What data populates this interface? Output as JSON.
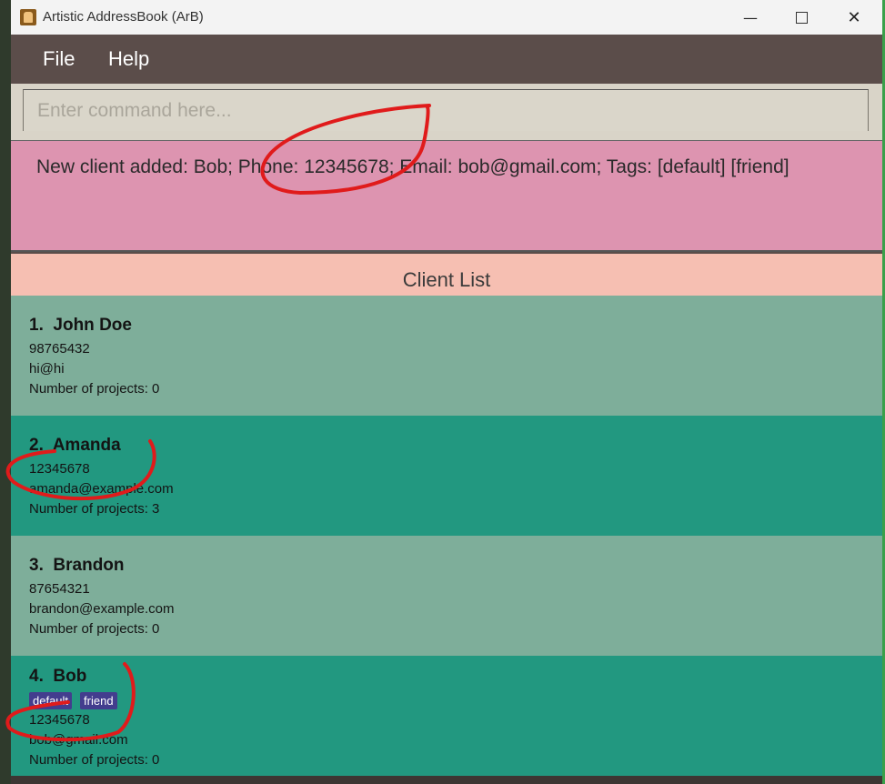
{
  "window": {
    "title": "Artistic AddressBook (ArB)"
  },
  "window_controls": {
    "minimize": "—",
    "close": "✕"
  },
  "menu": {
    "file": "File",
    "help": "Help"
  },
  "command": {
    "placeholder": "Enter command here...",
    "value": ""
  },
  "result": {
    "message": "New client added: Bob; Phone: 12345678; Email: bob@gmail.com; Tags: [default] [friend]"
  },
  "client_list": {
    "title": "Client List",
    "clients": [
      {
        "name": "1.  John Doe",
        "phone": "98765432",
        "email": "hi@hi",
        "projects": "Number of projects: 0",
        "tags": []
      },
      {
        "name": "2.  Amanda",
        "phone": "12345678",
        "email": "amanda@example.com",
        "projects": "Number of projects: 3",
        "tags": []
      },
      {
        "name": "3.  Brandon",
        "phone": "87654321",
        "email": "brandon@example.com",
        "projects": "Number of projects: 0",
        "tags": []
      },
      {
        "name": "4.  Bob",
        "phone": "12345678",
        "email": "bob@gmail.com",
        "projects": "Number of projects: 0",
        "tags": [
          "default",
          "friend"
        ]
      }
    ]
  },
  "colors": {
    "menu_bar": "#5b4d4a",
    "result_bg": "#dd94b0",
    "header_bg": "#f6bfb2",
    "card_light": "#7eae9a",
    "card_dark": "#229880",
    "tag_bg": "#433d8e",
    "annotation": "#e01b1b"
  }
}
